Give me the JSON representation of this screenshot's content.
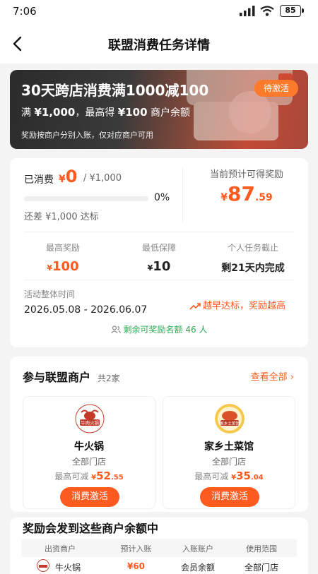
{
  "status": {
    "time": "7:06",
    "battery": "85"
  },
  "nav": {
    "title": "联盟消费任务详情"
  },
  "banner": {
    "title": "30天跨店消费满1000减100",
    "sub_prefix": "满",
    "sub_min": "¥1,000",
    "sub_mid": "，最高得",
    "sub_reward": "¥100",
    "sub_suffix": "商户余额",
    "note": "奖励按商户分别入账，仅对应商户可用",
    "badge": "待激活"
  },
  "progress": {
    "spent_label": "已消费",
    "spent_currency": "¥",
    "spent_value": "0",
    "spent_total": "/  ¥1,000",
    "percent": "0%",
    "fraction": 0,
    "remaining": "还差 ¥1,000 达标",
    "est_label": "当前预计可得奖励",
    "est_currency": "¥",
    "est_int": "87",
    "est_dec": ".59"
  },
  "stats": [
    {
      "label": "最高奖励",
      "currency": "¥",
      "value": "100"
    },
    {
      "label": "最低保障",
      "currency": "¥",
      "value": "10"
    },
    {
      "label": "个人任务截止",
      "value": "剩21天内完成"
    }
  ],
  "activity": {
    "label": "活动整体时间",
    "dates": "2026.05.08 - 2026.06.07",
    "early": "越早达标，奖励越高",
    "quota_prefix": "剩余可奖励名额",
    "quota_count": "46",
    "quota_suffix": "人"
  },
  "merchants": {
    "title": "参与联盟商户",
    "count": "共2家",
    "view_all": "查看全部",
    "items": [
      {
        "name": "牛火锅",
        "logo_text": "牛肉火锅",
        "stores": "全部门店",
        "max_label": "最高可减",
        "max_currency": "¥",
        "max_int": "52",
        "max_dec": ".55",
        "button": "消费激活"
      },
      {
        "name": "家乡土菜馆",
        "logo_text": "家乡土菜馆",
        "stores": "全部门店",
        "max_label": "最高可减",
        "max_currency": "¥",
        "max_int": "35",
        "max_dec": ".04",
        "button": "消费激活"
      }
    ]
  },
  "rewards": {
    "title": "奖励会发到这些商户余额中",
    "headers": [
      "出资商户",
      "预计入账",
      "入账账户",
      "使用范围"
    ],
    "rows": [
      {
        "merchant": "牛火锅",
        "amount": "¥60",
        "account": "会员余额",
        "scope": "全部门店"
      }
    ]
  }
}
